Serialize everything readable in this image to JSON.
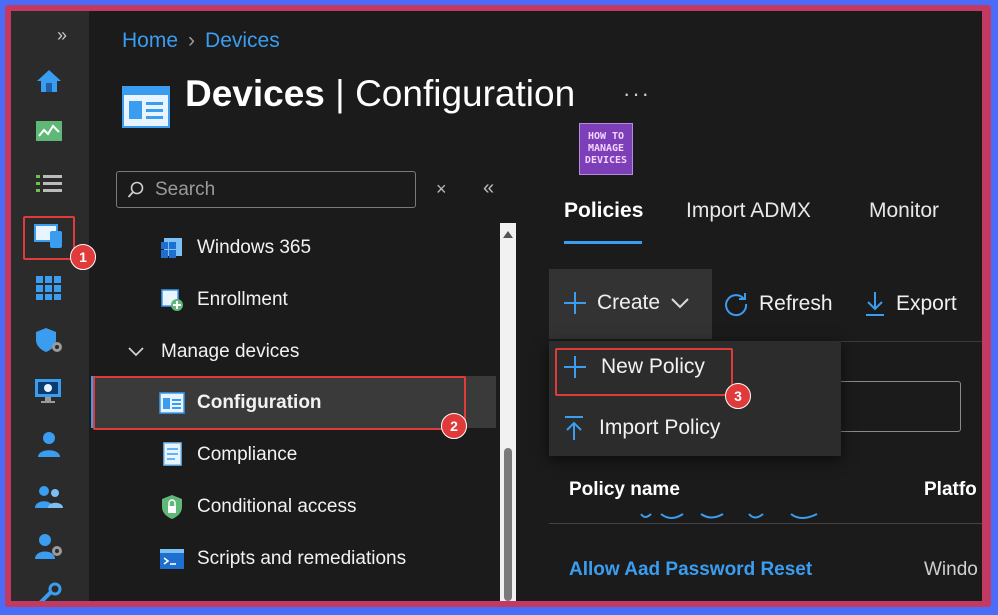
{
  "breadcrumb": {
    "home": "Home",
    "devices": "Devices"
  },
  "page": {
    "title_bold": "Devices",
    "title_sep": " | ",
    "title_rest": "Configuration",
    "more": "···"
  },
  "logo": {
    "line1": "HOW TO",
    "line2": "MANAGE",
    "line3": "DEVICES"
  },
  "rail": {
    "expand": "»",
    "icons": [
      "home-icon",
      "dashboard-icon",
      "all-services-icon",
      "devices-icon",
      "apps-icon",
      "endpoint-security-icon",
      "reports-icon",
      "users-icon",
      "groups-icon",
      "tenant-admin-icon",
      "troubleshooting-icon"
    ]
  },
  "subnav": {
    "search_placeholder": "Search",
    "clear": "×",
    "collapse": "«",
    "items": [
      {
        "label": "Windows 365"
      },
      {
        "label": "Enrollment"
      },
      {
        "label": "Manage devices"
      },
      {
        "label": "Configuration"
      },
      {
        "label": "Compliance"
      },
      {
        "label": "Conditional access"
      },
      {
        "label": "Scripts and remediations"
      }
    ]
  },
  "tabs": [
    {
      "label": "Policies"
    },
    {
      "label": "Import ADMX"
    },
    {
      "label": "Monitor"
    }
  ],
  "toolbar": {
    "create": "Create",
    "refresh": "Refresh",
    "export": "Export"
  },
  "create_menu": {
    "new_policy": "New Policy",
    "import_policy": "Import Policy"
  },
  "table": {
    "headers": [
      "Policy name",
      "Platfo"
    ],
    "rows": [
      {
        "name": "Allow Aad Password Reset",
        "platform": "Windo"
      }
    ]
  },
  "callouts": [
    "1",
    "2",
    "3"
  ],
  "colors": {
    "accent": "#3a9df0",
    "callout": "#e03a3a",
    "background": "#1b1b1b"
  }
}
